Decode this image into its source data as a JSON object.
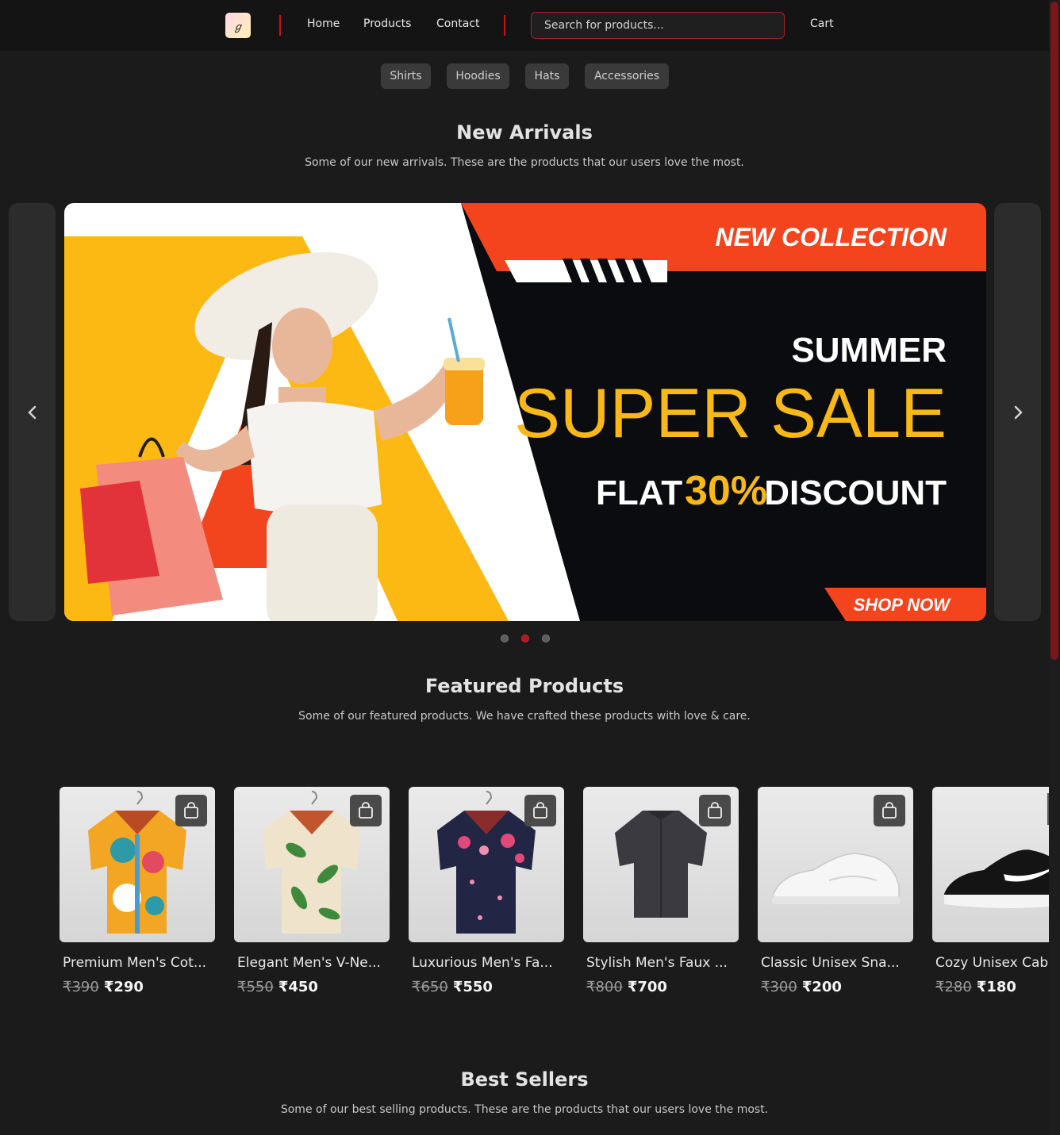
{
  "header": {
    "logo_text": "ℊ",
    "nav": [
      "Home",
      "Products",
      "Contact"
    ],
    "search_placeholder": "Search for products...",
    "cart_label": "Cart"
  },
  "categories": [
    "Shirts",
    "Hoodies",
    "Hats",
    "Accessories"
  ],
  "new_arrivals": {
    "title": "New Arrivals",
    "subtitle": "Some of our new arrivals. These are the products that our users love the most."
  },
  "carousel": {
    "prev_icon": "chevron-left-icon",
    "next_icon": "chevron-right-icon",
    "slide_count": 3,
    "active_slide": 2,
    "banner": {
      "tag": "NEW COLLECTION",
      "line1": "SUMMER",
      "line2": "SUPER SALE",
      "flat": "FLAT",
      "percent": "30%",
      "discount": "DISCOUNT",
      "cta": "SHOP NOW"
    }
  },
  "featured": {
    "title": "Featured Products",
    "subtitle": "Some of our featured products. We have crafted these products with love & care.",
    "products": [
      {
        "name": "Premium Men's Cot...",
        "old_price": "₹390",
        "price": "₹290",
        "image": "colorful-floral-shirt"
      },
      {
        "name": "Elegant Men's V-Ne...",
        "old_price": "₹550",
        "price": "₹450",
        "image": "leaf-print-shirt"
      },
      {
        "name": "Luxurious Men's Fa...",
        "old_price": "₹650",
        "price": "₹550",
        "image": "navy-floral-shirt"
      },
      {
        "name": "Stylish Men's Faux ...",
        "old_price": "₹800",
        "price": "₹700",
        "image": "dark-grey-shirt"
      },
      {
        "name": "Classic Unisex Sna...",
        "old_price": "₹300",
        "price": "₹200",
        "image": "white-sneaker"
      },
      {
        "name": "Cozy Unisex Cabin",
        "old_price": "₹280",
        "price": "₹180",
        "image": "black-running-shoe"
      }
    ]
  },
  "best_sellers": {
    "title": "Best Sellers",
    "subtitle": "Some of our best selling products. These are the products that our users love the most."
  },
  "colors": {
    "accent": "#c4161c",
    "background": "#1b1b1c",
    "header": "#141415",
    "chip": "#3a3a3b"
  }
}
